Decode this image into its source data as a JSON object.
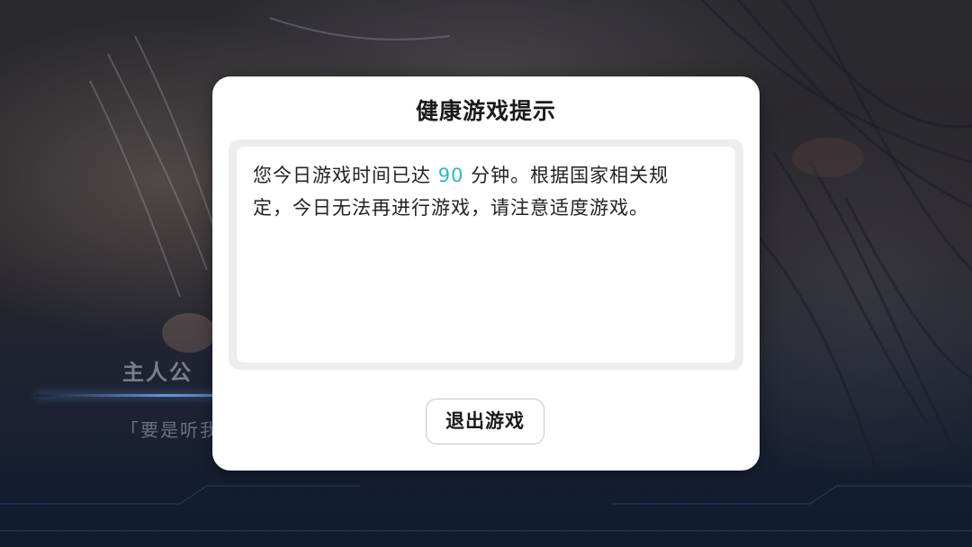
{
  "background": {
    "speaker_name": "主人公",
    "dialogue_line": "「要是听我"
  },
  "dialog": {
    "title": "健康游戏提示",
    "message_part1": "您今日游戏时间已达 ",
    "message_minutes": "90",
    "message_part2": " 分钟。根据国家相关规定，今日无法再进行游戏，请注意适度游戏。",
    "exit_button_label": "退出游戏",
    "highlight_color": "#2bb7c4"
  }
}
